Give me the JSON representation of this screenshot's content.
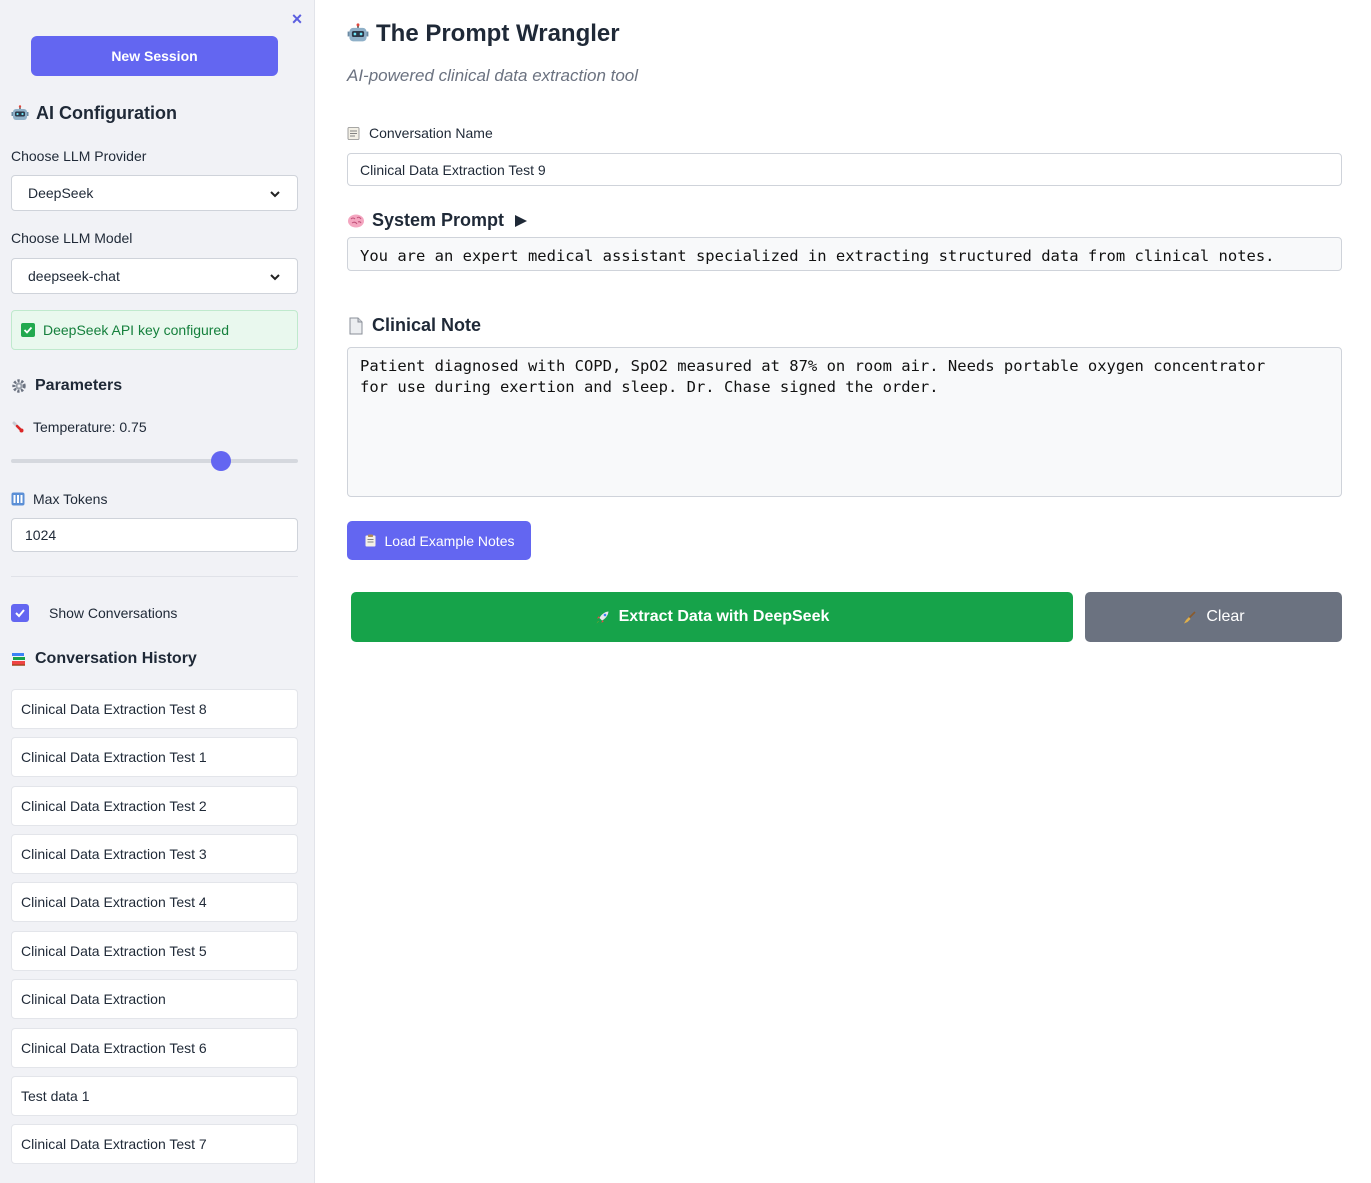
{
  "sidebar": {
    "close_glyph": "×",
    "new_session_label": "New Session",
    "ai_config_title": "AI Configuration",
    "provider_label": "Choose LLM Provider",
    "provider_value": "DeepSeek",
    "model_label": "Choose LLM Model",
    "model_value": "deepseek-chat",
    "api_status": "DeepSeek API key configured",
    "parameters_title": "Parameters",
    "temperature_label": "Temperature: 0.75",
    "temperature": {
      "value": 0.75,
      "min": 0,
      "max": 1
    },
    "max_tokens_label": "Max Tokens",
    "max_tokens_value": "1024",
    "show_conversations_label": "Show Conversations",
    "show_conversations_checked": true,
    "history_title": "Conversation History",
    "conversations": [
      "Clinical Data Extraction Test 8",
      "Clinical Data Extraction Test 1",
      "Clinical Data Extraction Test 2",
      "Clinical Data Extraction Test 3",
      "Clinical Data Extraction Test 4",
      "Clinical Data Extraction Test 5",
      "Clinical Data Extraction",
      "Clinical Data Extraction Test 6",
      "Test data 1",
      "Clinical Data Extraction Test 7"
    ]
  },
  "main": {
    "title": "The Prompt Wrangler",
    "subtitle": "AI-powered clinical data extraction tool",
    "conversation_name_label": "Conversation Name",
    "conversation_name_value": "Clinical Data Extraction Test 9",
    "system_prompt_title": "System Prompt",
    "system_prompt_value": "You are an expert medical assistant specialized in extracting structured data from clinical notes.",
    "clinical_note_title": "Clinical Note",
    "clinical_note_value": "Patient diagnosed with COPD, SpO2 measured at 87% on room air. Needs portable oxygen concentrator\nfor use during exertion and sleep. Dr. Chase signed the order.",
    "load_example_label": "Load Example Notes",
    "extract_label": "Extract Data with DeepSeek",
    "clear_label": "Clear"
  },
  "colors": {
    "accent": "#6366f1",
    "success": "#16a34a",
    "neutral_button": "#6b7280",
    "sidebar_bg": "#f1f2f6"
  },
  "icons": {
    "close": "close-icon",
    "robot": "robot-icon",
    "gear": "gear-icon",
    "thermometer": "thermometer-icon",
    "numbers": "numbers-icon",
    "books": "books-icon",
    "memo": "memo-icon",
    "brain": "brain-icon",
    "page": "page-icon",
    "clipboard": "clipboard-icon",
    "rocket": "rocket-icon",
    "broom": "broom-icon"
  }
}
